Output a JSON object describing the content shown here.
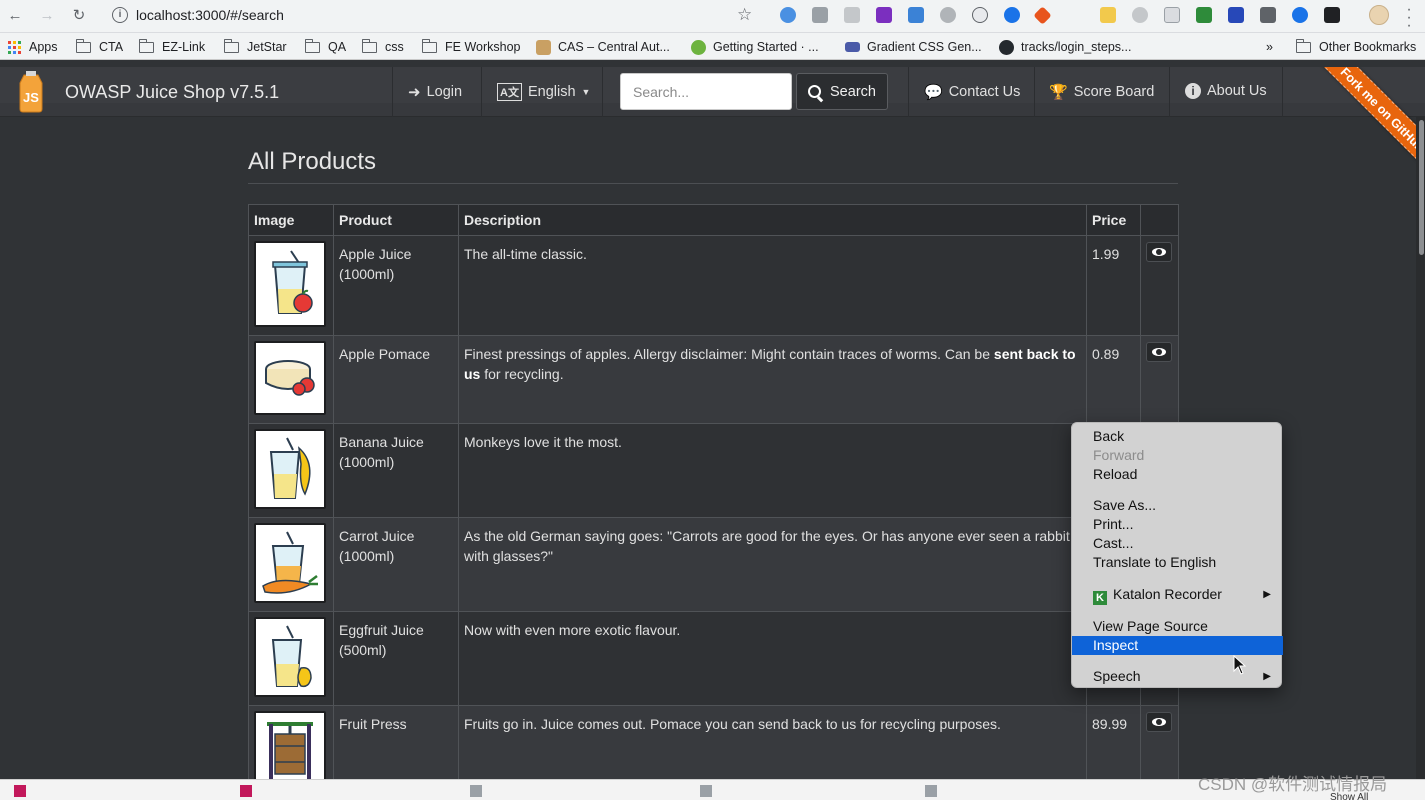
{
  "browser": {
    "url": "localhost:3000/#/search",
    "bookmarks": [
      {
        "label": "Apps"
      },
      {
        "label": "CTA"
      },
      {
        "label": "EZ-Link"
      },
      {
        "label": "JetStar"
      },
      {
        "label": "QA"
      },
      {
        "label": "css"
      },
      {
        "label": "FE Workshop"
      },
      {
        "label": "CAS – Central Aut..."
      },
      {
        "label": "Getting Started · ..."
      },
      {
        "label": "Gradient CSS Gen..."
      },
      {
        "label": "tracks/login_steps..."
      }
    ],
    "more_bookmarks": "»",
    "other_bookmarks": "Other Bookmarks"
  },
  "navbar": {
    "brand": "OWASP Juice Shop v7.5.1",
    "login": "Login",
    "language": "English",
    "search_placeholder": "Search...",
    "search_button": "Search",
    "contact": "Contact Us",
    "scoreboard": "Score Board",
    "about": "About Us",
    "ribbon": "Fork me on GitHub"
  },
  "main": {
    "title": "All Products",
    "columns": [
      "Image",
      "Product",
      "Description",
      "Price"
    ],
    "products": [
      {
        "name": "Apple Juice (1000ml)",
        "description": "The all-time classic.",
        "price": "1.99"
      },
      {
        "name": "Apple Pomace",
        "desc_pre": "Finest pressings of apples. Allergy disclaimer: Might contain traces of worms. Can be ",
        "desc_bold": "sent back to us",
        "desc_post": " for recycling.",
        "price": "0.89"
      },
      {
        "name": "Banana Juice (1000ml)",
        "description": "Monkeys love it the most.",
        "price": ""
      },
      {
        "name": "Carrot Juice (1000ml)",
        "description": "As the old German saying goes: \"Carrots are good for the eyes. Or has anyone ever seen a rabbit with glasses?\"",
        "price": ""
      },
      {
        "name": "Eggfruit Juice (500ml)",
        "description": "Now with even more exotic flavour.",
        "price": ""
      },
      {
        "name": "Fruit Press",
        "description": "Fruits go in. Juice comes out. Pomace you can send back to us for recycling purposes.",
        "price": "89.99"
      }
    ]
  },
  "context_menu": {
    "back": "Back",
    "forward": "Forward",
    "reload": "Reload",
    "save_as": "Save As...",
    "print": "Print...",
    "cast": "Cast...",
    "translate": "Translate to English",
    "katalon": "Katalon Recorder",
    "view_source": "View Page Source",
    "inspect": "Inspect",
    "speech": "Speech"
  },
  "watermark": "CSDN @软件测试情报局",
  "bottom": {
    "show_all": "Show All"
  },
  "colors": {
    "accent": "#0e63d8",
    "ribbon": "#e8650d",
    "background": "#303336"
  }
}
